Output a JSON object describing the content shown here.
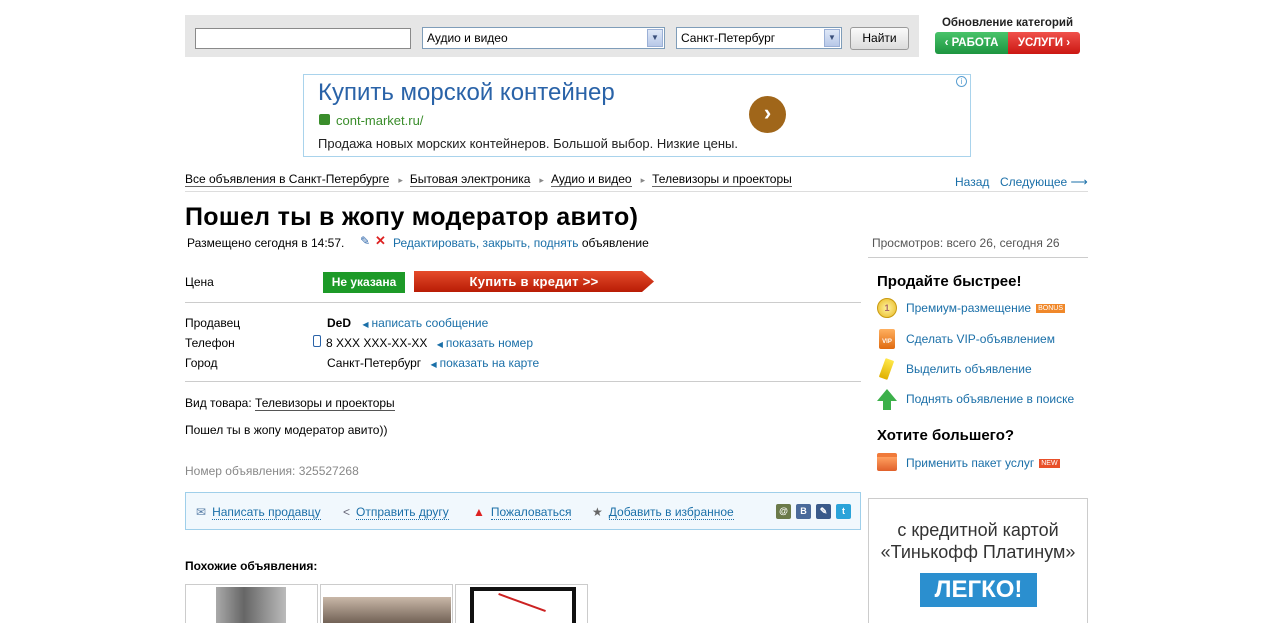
{
  "search": {
    "query_value": "",
    "category_value": "Аудио и видео",
    "city_value": "Санкт-Петербург",
    "button_label": "Найти"
  },
  "categories_update": {
    "title": "Обновление категорий",
    "work_label": "‹ РАБОТА",
    "services_label": "УСЛУГИ ›"
  },
  "ad": {
    "title": "Купить морской контейнер",
    "url": "cont-market.ru/",
    "description": "Продажа новых морских контейнеров. Большой выбор. Низкие цены.",
    "go_symbol": "›",
    "info_symbol": "i"
  },
  "breadcrumb": {
    "items": [
      "Все объявления в Санкт-Петербурге",
      "Бытовая электроника",
      "Аудио и видео",
      "Телевизоры и проекторы"
    ],
    "sep": "▸",
    "prev_label": "Назад",
    "next_label": "Следующее ⟶"
  },
  "listing": {
    "title": "Пошел ты в жопу модератор авито)",
    "posted": "Размещено сегодня в 14:57.",
    "edit_links": "Редактировать, закрыть, поднять",
    "edit_suffix": "объявление",
    "views": "Просмотров: всего 26, сегодня 26",
    "price_label": "Цена",
    "price_value": "Не указана",
    "credit_button": "Купить в кредит >>",
    "seller_label": "Продавец",
    "seller_name": "DeD",
    "seller_action": "написать сообщение",
    "phone_label": "Телефон",
    "phone_value": "8 XXX XXX-XX-XX",
    "phone_action": "показать номер",
    "city_label": "Город",
    "city_value": "Санкт-Петербург",
    "city_action": "показать на карте",
    "type_label": "Вид товара:",
    "type_value": "Телевизоры и проекторы",
    "description": "Пошел ты в жопу модератор авито))",
    "number": "Номер объявления: 325527268"
  },
  "actions": {
    "write": "Написать продавцу",
    "send": "Отправить другу",
    "report": "Пожаловаться",
    "favorite": "Добавить в избранное",
    "social": [
      "@",
      "В",
      "✎",
      "t"
    ],
    "social_colors": [
      "#6b7a4a",
      "#4a6a9a",
      "#3a5a8a",
      "#2aa3d9"
    ]
  },
  "similar": {
    "title": "Похожие объявления:"
  },
  "sidebar": {
    "sell_title": "Продайте быстрее!",
    "items": [
      {
        "label": "Премиум-размещение",
        "tag": "BONUS",
        "icon": "premium-icon"
      },
      {
        "label": "Сделать VIP-объявлением",
        "tag": "",
        "icon": "vip-icon"
      },
      {
        "label": "Выделить объявление",
        "tag": "",
        "icon": "highlight-icon"
      },
      {
        "label": "Поднять объявление в поиске",
        "tag": "",
        "icon": "up-arrow-icon"
      }
    ],
    "want_title": "Хотите большего?",
    "package_label": "Применить пакет услуг",
    "package_tag": "NEW"
  },
  "promo": {
    "line1": "с кредитной картой",
    "line2": "«Тинькофф Платинум»",
    "button": "ЛЕГКО!"
  }
}
